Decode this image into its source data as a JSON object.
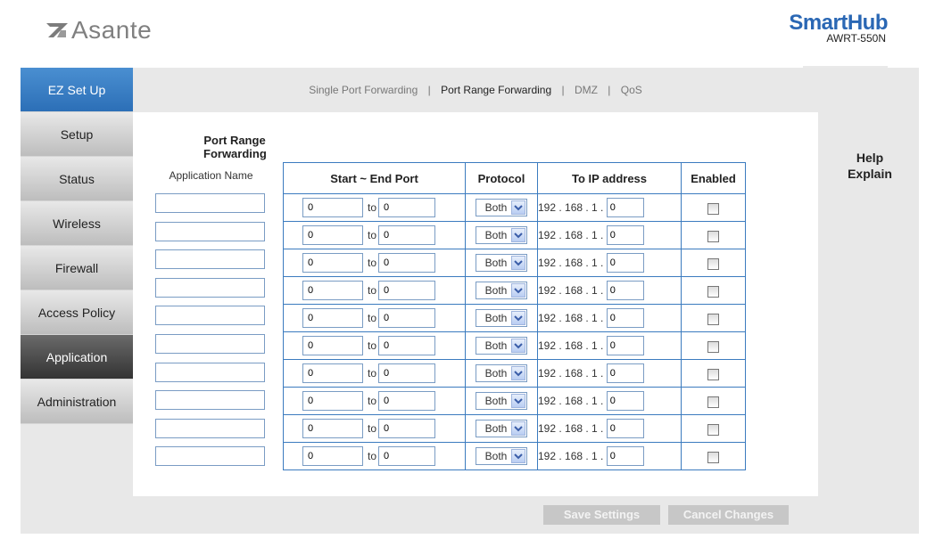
{
  "brand": {
    "asante": "Asante",
    "smarthub": "SmartHub",
    "model": "AWRT-550N"
  },
  "sidebar": {
    "items": [
      {
        "label": "EZ Set Up"
      },
      {
        "label": "Setup"
      },
      {
        "label": "Status"
      },
      {
        "label": "Wireless"
      },
      {
        "label": "Firewall"
      },
      {
        "label": "Access Policy"
      },
      {
        "label": "Application"
      },
      {
        "label": "Administration"
      }
    ],
    "active": "Application"
  },
  "subnav": {
    "items": [
      {
        "label": "Single Port Forwarding"
      },
      {
        "label": "Port Range Forwarding"
      },
      {
        "label": "DMZ"
      },
      {
        "label": "QoS"
      }
    ],
    "separator": "|",
    "active": "Port Range Forwarding"
  },
  "page": {
    "heading": "Port Range Forwarding",
    "help_line1": "Help",
    "help_line2": "Explain"
  },
  "table": {
    "headers": {
      "app_name": "Application Name",
      "ports": "Start ~ End Port",
      "protocol": "Protocol",
      "ip": "To IP address",
      "enabled": "Enabled"
    },
    "to_label": "to",
    "ip_prefix": "192 . 168 . 1 .",
    "rows": [
      {
        "app": "",
        "start": "0",
        "end": "0",
        "protocol": "Both",
        "ip_last": "0",
        "enabled": false
      },
      {
        "app": "",
        "start": "0",
        "end": "0",
        "protocol": "Both",
        "ip_last": "0",
        "enabled": false
      },
      {
        "app": "",
        "start": "0",
        "end": "0",
        "protocol": "Both",
        "ip_last": "0",
        "enabled": false
      },
      {
        "app": "",
        "start": "0",
        "end": "0",
        "protocol": "Both",
        "ip_last": "0",
        "enabled": false
      },
      {
        "app": "",
        "start": "0",
        "end": "0",
        "protocol": "Both",
        "ip_last": "0",
        "enabled": false
      },
      {
        "app": "",
        "start": "0",
        "end": "0",
        "protocol": "Both",
        "ip_last": "0",
        "enabled": false
      },
      {
        "app": "",
        "start": "0",
        "end": "0",
        "protocol": "Both",
        "ip_last": "0",
        "enabled": false
      },
      {
        "app": "",
        "start": "0",
        "end": "0",
        "protocol": "Both",
        "ip_last": "0",
        "enabled": false
      },
      {
        "app": "",
        "start": "0",
        "end": "0",
        "protocol": "Both",
        "ip_last": "0",
        "enabled": false
      },
      {
        "app": "",
        "start": "0",
        "end": "0",
        "protocol": "Both",
        "ip_last": "0",
        "enabled": false
      }
    ]
  },
  "buttons": {
    "save": "Save Settings",
    "cancel": "Cancel Changes"
  },
  "colors": {
    "accent_blue": "#2c6fb7",
    "table_border": "#3b7bbf",
    "active_nav": "#333333",
    "button_gray": "#c7c7c7"
  },
  "icons": {
    "logo": "asante-logo-icon",
    "dropdown": "chevron-down-icon"
  }
}
